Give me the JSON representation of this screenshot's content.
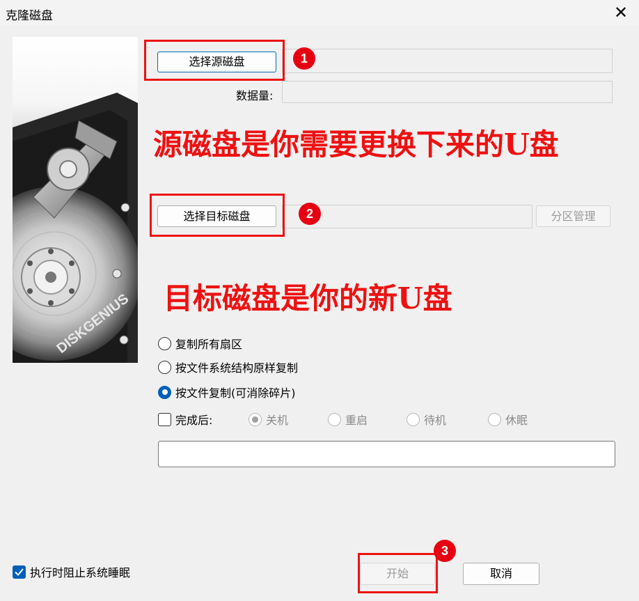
{
  "window": {
    "title": "克隆磁盘"
  },
  "side_image": {
    "brand": "DISKGENIUS"
  },
  "source": {
    "button_label": "选择源磁盘",
    "value": ""
  },
  "data_size": {
    "label": "数据量:",
    "value": ""
  },
  "target": {
    "button_label": "选择目标磁盘",
    "value": "",
    "partition_label": "分区管理"
  },
  "notes": {
    "source": "源磁盘是你需要更换下来的U盘",
    "target": "目标磁盘是你的新U盘"
  },
  "badges": [
    "1",
    "2",
    "3"
  ],
  "copy_modes": {
    "options": [
      "复制所有扇区",
      "按文件系统结构原样复制",
      "按文件复制(可消除碎片)"
    ],
    "selected": "按文件复制(可消除碎片)"
  },
  "after_complete": {
    "label": "完成后:",
    "checked": false,
    "options": [
      "关机",
      "重启",
      "待机",
      "休眠"
    ],
    "selected": "关机"
  },
  "progress": {
    "text": ""
  },
  "prevent_sleep": {
    "label": "执行时阻止系统睡眠",
    "checked": true
  },
  "buttons": {
    "start": "开始",
    "cancel": "取消"
  },
  "colors": {
    "annotation_red": "#ee1111",
    "badge_red": "#e60012",
    "accent_blue": "#005fb8"
  }
}
